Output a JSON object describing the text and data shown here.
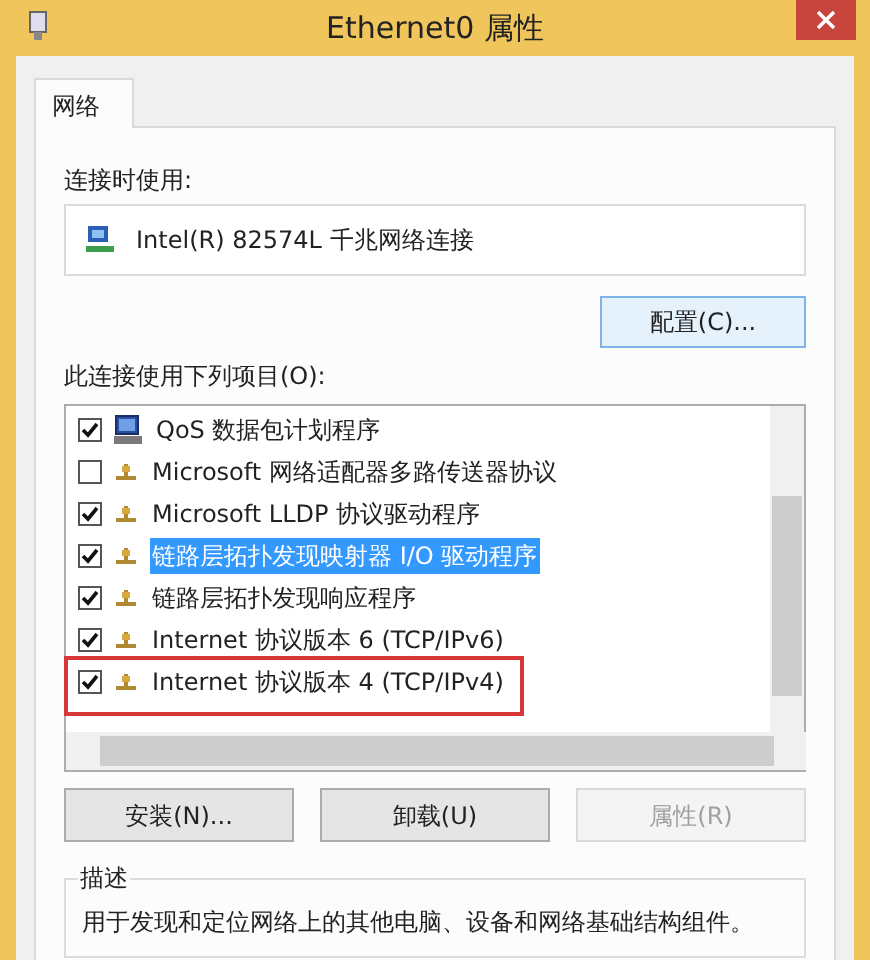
{
  "window": {
    "title": "Ethernet0 属性"
  },
  "tabs": [
    {
      "label": "网络",
      "selected": true
    }
  ],
  "connect_using": {
    "label": "连接时使用:",
    "adapter": "Intel(R) 82574L 千兆网络连接",
    "configure_button": "配置(C)..."
  },
  "items_label": "此连接使用下列项目(O):",
  "items": [
    {
      "label": "QoS 数据包计划程序",
      "kind": "service",
      "checked": true,
      "selected": false,
      "highlighted": false
    },
    {
      "label": "Microsoft 网络适配器多路传送器协议",
      "kind": "protocol",
      "checked": false,
      "selected": false,
      "highlighted": false
    },
    {
      "label": "Microsoft LLDP 协议驱动程序",
      "kind": "protocol",
      "checked": true,
      "selected": false,
      "highlighted": false
    },
    {
      "label": "链路层拓扑发现映射器 I/O 驱动程序",
      "kind": "protocol",
      "checked": true,
      "selected": true,
      "highlighted": false
    },
    {
      "label": "链路层拓扑发现响应程序",
      "kind": "protocol",
      "checked": true,
      "selected": false,
      "highlighted": false
    },
    {
      "label": "Internet 协议版本 6 (TCP/IPv6)",
      "kind": "protocol",
      "checked": true,
      "selected": false,
      "highlighted": false
    },
    {
      "label": "Internet 协议版本 4 (TCP/IPv4)",
      "kind": "protocol",
      "checked": true,
      "selected": false,
      "highlighted": true
    }
  ],
  "buttons": [
    {
      "label": "安装(N)...",
      "disabled": false
    },
    {
      "label": "卸载(U)",
      "disabled": false
    },
    {
      "label": "属性(R)",
      "disabled": true
    }
  ],
  "description": {
    "legend": "描述",
    "lines": [
      "用于发现和定位网络上的其他电脑、设备和网络基础结构组件。"
    ]
  }
}
